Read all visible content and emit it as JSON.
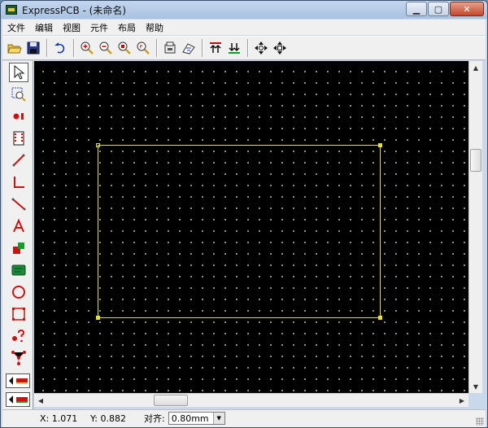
{
  "window": {
    "title": "ExpressPCB - (未命名)",
    "controls": {
      "minimize": "▁",
      "maximize": "▢",
      "close": "✕"
    }
  },
  "menu": [
    "文件",
    "编辑",
    "视图",
    "元件",
    "布局",
    "帮助"
  ],
  "toolbar": {
    "buttons": [
      "open-folder-icon",
      "save-icon",
      "undo-icon",
      "zoom-in-icon",
      "zoom-out-icon",
      "zoom-window-icon",
      "zoom-page-icon",
      "properties-icon",
      "component-lib-icon",
      "top-layer-icon",
      "bottom-layer-icon",
      "pan-icon",
      "move-icon"
    ]
  },
  "left_tools": [
    "select-arrow-icon",
    "zoom-select-icon",
    "pad-icon",
    "component-icon",
    "trace-icon",
    "corner-trace-icon",
    "diagonal-trace-icon",
    "text-icon",
    "layer-swap-icon",
    "board-shape-icon",
    "circle-icon",
    "rect-icon",
    "query-icon",
    "netlist-icon"
  ],
  "colors": {
    "canvas": "#000000",
    "board_outline": "#e6e03a",
    "grid_dot": "#d8d8d8"
  },
  "status": {
    "x": "X: 1.071",
    "y": "Y: 0.882",
    "grid_label": "对齐:",
    "grid_value": "0.80mm"
  }
}
